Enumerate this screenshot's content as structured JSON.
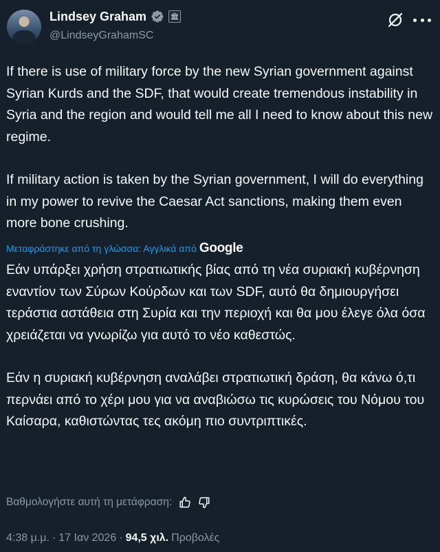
{
  "author": {
    "name": "Lindsey Graham",
    "handle": "@LindseyGrahamSC",
    "affiliation_badge": "🏛",
    "verified_color": "#8b98a5",
    "avatar": "avatar-photo"
  },
  "actions": {
    "grok_icon": "grok-slash-icon",
    "more_icon": "more-dots-icon"
  },
  "tweet": {
    "paragraph1": "If there is use of military force by the new Syrian government against Syrian Kurds and the SDF, that would create tremendous instability in Syria and the region and would tell me all I need to know about this new regime.",
    "paragraph2": "If military action is taken by the Syrian government, I will do everything in my power to revive the Caesar Act sanctions, making them even more bone crushing."
  },
  "translation": {
    "label": "Μεταφράστηκε από τη γλώσσα: Αγγλικά από",
    "provider": "Google",
    "paragraph1": "Εάν υπάρξει χρήση στρατιωτικής βίας από τη νέα συριακή κυβέρνηση εναντίον των Σύρων Κούρδων και των SDF, αυτό θα δημιουργήσει τεράστια αστάθεια στη Συρία και την περιοχή και θα μου έλεγε όλα όσα χρειάζεται να γνωρίζω για αυτό το νέο καθεστώς.",
    "paragraph2": "Εάν η συριακή κυβέρνηση αναλάβει στρατιωτική δράση, θα κάνω ό,τι περνάει από το χέρι μου για να αναβιώσω τις κυρώσεις του Νόμου του Καίσαρα, καθιστώντας τες ακόμη πιο συντριπτικές.",
    "rate_label": "Βαθμολογήστε αυτή τη μετάφραση:"
  },
  "meta": {
    "time": "4:38 μ.μ.",
    "separator": "·",
    "date": "17 Ιαν 2026",
    "views_count": "94,5 χιλ.",
    "views_label": "Προβολές"
  },
  "colors": {
    "background": "#15202b",
    "text": "#f7f9f9",
    "secondary": "#8b98a5",
    "link": "#1d9bf0"
  }
}
